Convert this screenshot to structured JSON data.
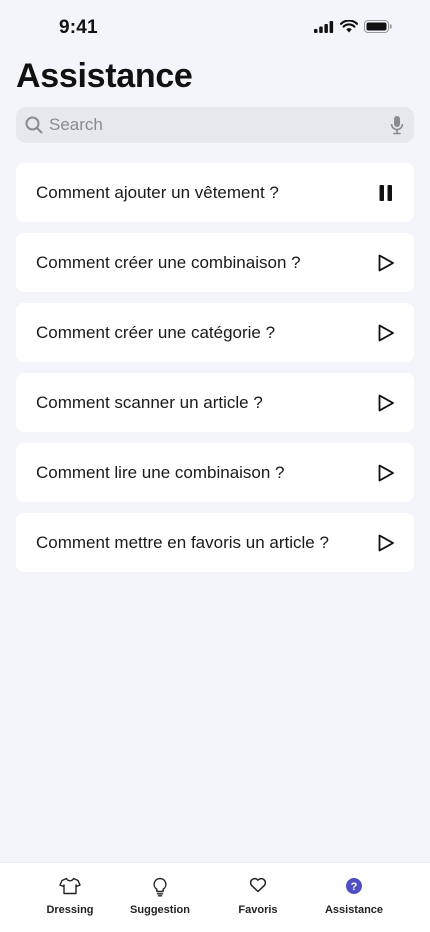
{
  "status_bar": {
    "time": "9:41"
  },
  "page": {
    "title": "Assistance"
  },
  "search": {
    "placeholder": "Search",
    "value": ""
  },
  "faq": [
    {
      "label": "Comment ajouter un vêtement ?",
      "state": "pause",
      "icon": "pause-icon"
    },
    {
      "label": "Comment créer une combinaison ?",
      "state": "play",
      "icon": "play-icon"
    },
    {
      "label": "Comment créer une catégorie ?",
      "state": "play",
      "icon": "play-icon"
    },
    {
      "label": "Comment scanner un article ?",
      "state": "play",
      "icon": "play-icon"
    },
    {
      "label": "Comment lire une combinaison ?",
      "state": "play",
      "icon": "play-icon"
    },
    {
      "label": "Comment mettre en favoris un article ?",
      "state": "play",
      "icon": "play-icon"
    }
  ],
  "tab_bar": {
    "active": "Assistance",
    "accent_color": "#4f4fc4",
    "tabs": [
      {
        "label": "Dressing",
        "icon": "tshirt-icon"
      },
      {
        "label": "Suggestion",
        "icon": "lightbulb-icon"
      },
      {
        "label": "Favoris",
        "icon": "heart-icon"
      },
      {
        "label": "Assistance",
        "icon": "question-circle-icon"
      }
    ]
  }
}
